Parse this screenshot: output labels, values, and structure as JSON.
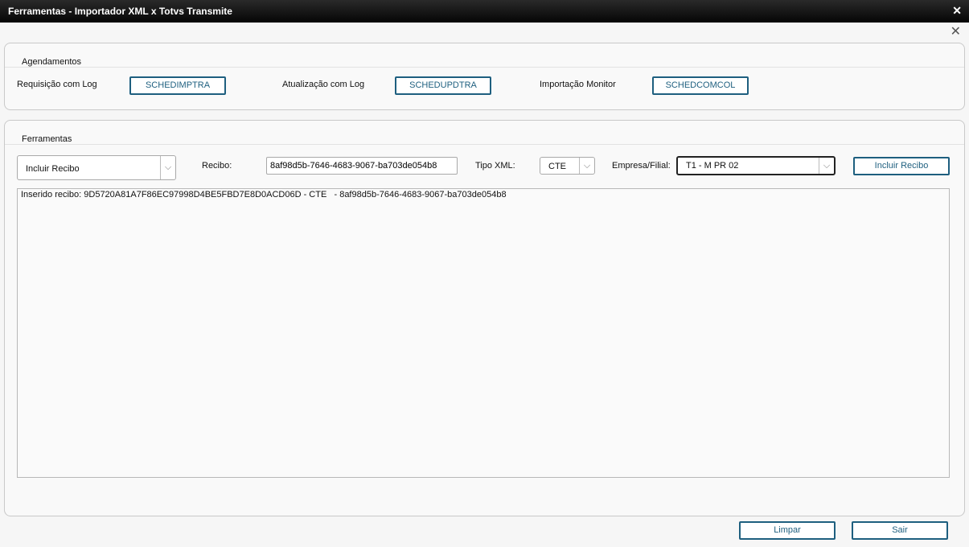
{
  "window": {
    "title": "Ferramentas - Importador XML x Totvs Transmite",
    "close_glyph": "✕",
    "inner_close_glyph": "✕"
  },
  "agendamentos": {
    "title": "Agendamentos",
    "items": [
      {
        "label": "Requisição com Log",
        "button": "SCHEDIMPTRA"
      },
      {
        "label": "Atualização com Log",
        "button": "SCHEDUPDTRA"
      },
      {
        "label": "Importação Monitor",
        "button": "SCHEDCOMCOL"
      }
    ]
  },
  "ferramentas": {
    "title": "Ferramentas",
    "action_select": "Incluir Recibo",
    "recibo_label": "Recibo:",
    "recibo_value": "8af98d5b-7646-4683-9067-ba703de054b8",
    "tipo_label": "Tipo XML:",
    "tipo_value": "CTE",
    "empresa_label": "Empresa/Filial:",
    "empresa_value": "T1 - M PR 02",
    "include_button": "Incluir Recibo",
    "log": "Inserido recibo: 9D5720A81A7F86EC97998D4BE5FBD7E8D0ACD06D - CTE   - 8af98d5b-7646-4683-9067-ba703de054b8"
  },
  "footer": {
    "limpar": "Limpar",
    "sair": "Sair"
  }
}
